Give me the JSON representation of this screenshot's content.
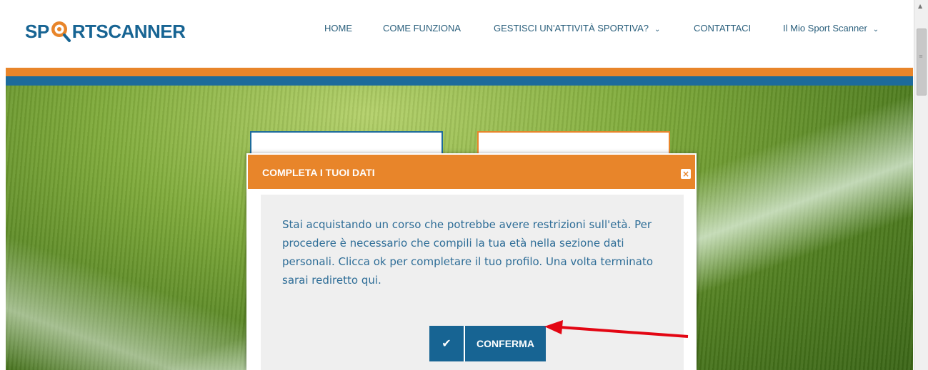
{
  "logo": {
    "text_before": "SP",
    "text_after": "RTSCANNER"
  },
  "nav": {
    "home": "HOME",
    "come_funziona": "COME FUNZIONA",
    "gestisci": "GESTISCI UN'ATTIVITÀ SPORTIVA?",
    "contattaci": "CONTATTACI",
    "mio_sport_scanner": "Il Mio Sport Scanner"
  },
  "icons": {
    "chevron": "chevron-down-icon",
    "close": "close-icon",
    "check": "check-icon",
    "logo_pin": "map-pin-magnifier-icon"
  },
  "colors": {
    "brand_blue": "#176493",
    "brand_orange": "#e8852a",
    "annotation_red": "#e30613"
  },
  "modal": {
    "title": "COMPLETA I TUOI DATI",
    "message": "Stai acquistando un corso che potrebbe avere restrizioni sull'età. Per procedere è necessario che compili la tua età nella sezione dati personali. Clicca ok per completare il tuo profilo. Una volta terminato sarai rediretto qui.",
    "confirm_label": "CONFERMA"
  }
}
